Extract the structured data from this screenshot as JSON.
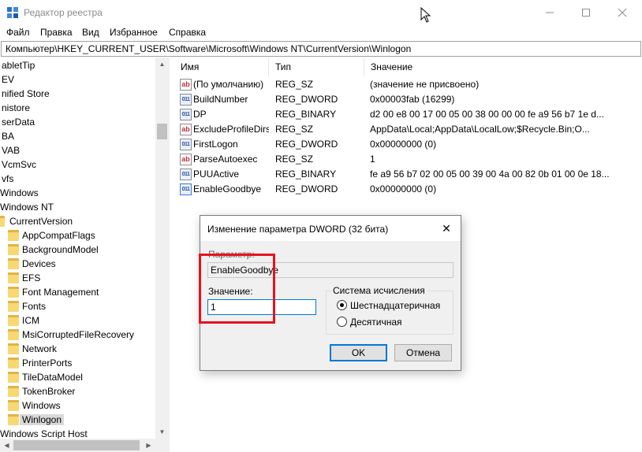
{
  "window": {
    "title": "Редактор реестра"
  },
  "menu": [
    "Файл",
    "Правка",
    "Вид",
    "Избранное",
    "Справка"
  ],
  "address": "Компьютер\\HKEY_CURRENT_USER\\Software\\Microsoft\\Windows NT\\CurrentVersion\\Winlogon",
  "tree": {
    "items": [
      "abletTip",
      "EV",
      "nified Store",
      "nistore",
      "serData",
      "BA",
      "VAB",
      "VcmSvc",
      "vfs",
      "Windows",
      "Windows NT",
      "CurrentVersion",
      "AppCompatFlags",
      "BackgroundModel",
      "Devices",
      "EFS",
      "Font Management",
      "Fonts",
      "ICM",
      "MsiCorruptedFileRecovery",
      "Network",
      "PrinterPorts",
      "TileDataModel",
      "TokenBroker",
      "Windows",
      "Winlogon",
      "Windows Script Host"
    ]
  },
  "list": {
    "headers": {
      "name": "Имя",
      "type": "Тип",
      "value": "Значение"
    },
    "rows": [
      {
        "icon": "string-value-icon",
        "name": "(По умолчанию)",
        "type": "REG_SZ",
        "value": "(значение не присвоено)"
      },
      {
        "icon": "binary-value-icon",
        "name": "BuildNumber",
        "type": "REG_DWORD",
        "value": "0x00003fab (16299)"
      },
      {
        "icon": "binary-value-icon",
        "name": "DP",
        "type": "REG_BINARY",
        "value": "d2 00 e8 00 17 00 05 00 38 00 00 00 fe a9 56 b7 1e d..."
      },
      {
        "icon": "string-value-icon",
        "name": "ExcludeProfileDirs",
        "type": "REG_SZ",
        "value": "AppData\\Local;AppData\\LocalLow;$Recycle.Bin;O..."
      },
      {
        "icon": "binary-value-icon",
        "name": "FirstLogon",
        "type": "REG_DWORD",
        "value": "0x00000000 (0)"
      },
      {
        "icon": "string-value-icon",
        "name": "ParseAutoexec",
        "type": "REG_SZ",
        "value": "1"
      },
      {
        "icon": "binary-value-icon",
        "name": "PUUActive",
        "type": "REG_BINARY",
        "value": "fe a9 56 b7 02 00 05 00 39 00 4a 00 82 0b 01 00 0e 18..."
      },
      {
        "icon": "binary-value-icon",
        "name": "EnableGoodbye",
        "type": "REG_DWORD",
        "value": "0x00000000 (0)"
      }
    ]
  },
  "dialog": {
    "title": "Изменение параметра DWORD (32 бита)",
    "param_label": "Параметр:",
    "param_value": "EnableGoodbye",
    "value_label": "Значение:",
    "value_input": "1",
    "base_group": "Система исчисления",
    "radio_hex": "Шестнадцатеричная",
    "radio_dec": "Десятичная",
    "ok": "OK",
    "cancel": "Отмена",
    "close_glyph": "✕"
  },
  "colors": {
    "highlight": "#e4131e",
    "accent": "#0078d7",
    "selected": "#d9d9d9"
  }
}
